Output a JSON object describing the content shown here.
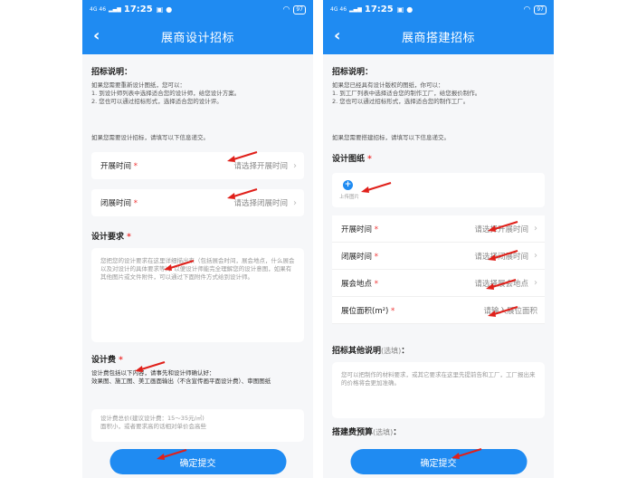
{
  "status_bar": {
    "signal": "4G 46",
    "time": "17:25",
    "battery": "97"
  },
  "left": {
    "nav_title": "展商设计招标",
    "intro_title": "招标说明：",
    "intro_text": "如果您需要重新设计图纸，您可以：\n1. 到设计师列表中选择适合您的设计师，给您设计方案。\n2. 您也可以通过招标形式，选择适合您的设计评。",
    "fill_note": "如果您需要设计招标，请填写以下信息递交。",
    "fields": [
      {
        "label": "开展时间",
        "placeholder": "请选择开展时间"
      },
      {
        "label": "闭展时间",
        "placeholder": "请选择闭展时间"
      }
    ],
    "design_req_title": "设计要求",
    "design_req_placeholder": "您把您的设计要求在这里详细描出来（包括展会时间，展会地点，什么展会以及对设计的具体要求等），以便设计师能完全理解您的设计意图，如果有其他图片或文件附件，可以通过下面附件方式给到设计师。",
    "fee_title": "设计费",
    "fee_desc": "设计费包括以下内容，请事先和设计师确认好：\n效果图、施工图、美工画面输出（不含宣传画平面设计费）、审图图纸",
    "fee_placeholder": "设计费总价(建议设计费：15～35元/㎡)\n面积小，或者要求高的话相对单价会高些",
    "submit_label": "确定提交"
  },
  "right": {
    "nav_title": "展商搭建招标",
    "intro_title": "招标说明：",
    "intro_text": "如果您已经具有设计版权的图纸，你可以：\n1. 到工厂列表中选择适合您的制作工厂，给您报价制作。\n2. 您也可以通过招标形式，选择适合您的制作工厂。",
    "fill_note": "如果您需要搭建招标，请填写以下信息递交。",
    "drawing_title": "设计图纸",
    "upload_label": "上传图片",
    "fields": [
      {
        "label": "开展时间",
        "placeholder": "请选择开展时间"
      },
      {
        "label": "闭展时间",
        "placeholder": "请选择闭展时间"
      },
      {
        "label": "展会地点",
        "placeholder": "请选择展会地点"
      },
      {
        "label": "展位面积(m²)",
        "placeholder": "请输入展位面积"
      }
    ],
    "other_title": "招标其他说明",
    "optional": "(选填)",
    "other_colon": "：",
    "other_placeholder": "您可以把制作的材料要求，或其它要求在这里先提前告和工厂，工厂报出来的价格将会更加准确。",
    "budget_title": "搭建费预算",
    "submit_label": "确定提交"
  },
  "colors": {
    "primary": "#1f8bf2",
    "arrow": "#e0201a",
    "required": "#e33333"
  },
  "icons": {
    "back": "chevron-left-icon",
    "row": "chevron-right-icon",
    "upload": "plus-circle-icon"
  }
}
